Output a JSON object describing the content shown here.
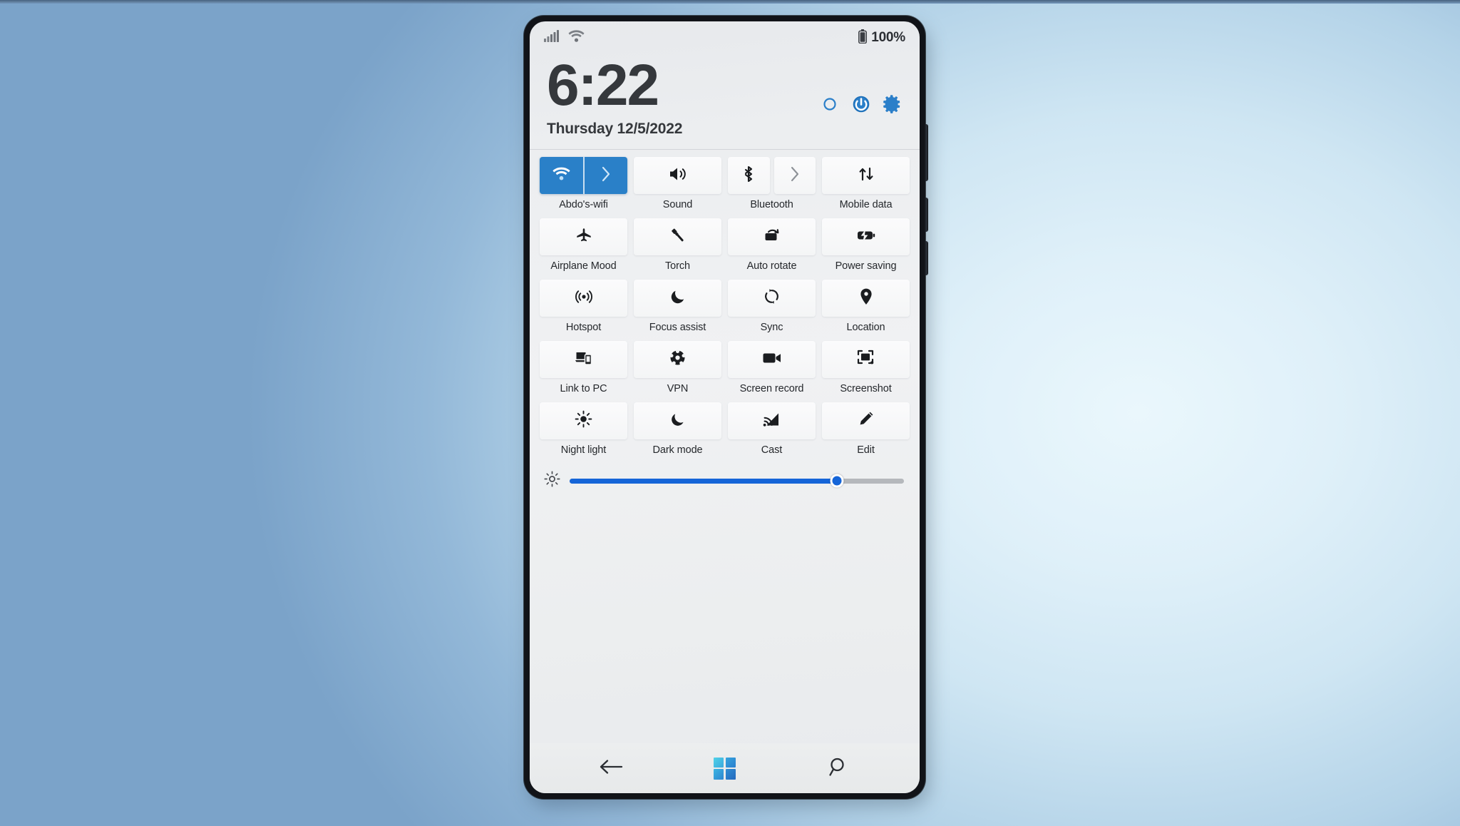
{
  "status_bar": {
    "signal_icon": "cellular-signal-icon",
    "wifi_icon": "wifi-icon",
    "battery_icon": "battery-full-icon",
    "battery_text": "100%"
  },
  "header": {
    "time": "6:22",
    "date": "Thursday 12/5/2022",
    "actions": [
      {
        "name": "night-light-ring-icon",
        "label": "Ring"
      },
      {
        "name": "power-icon",
        "label": "Power"
      },
      {
        "name": "gear-icon",
        "label": "Settings"
      }
    ]
  },
  "tiles": [
    {
      "label": "Abdo's-wifi",
      "icon": "wifi-icon",
      "state": "on",
      "layout": "split-joined"
    },
    {
      "label": "Sound",
      "icon": "speaker-icon",
      "state": "off",
      "layout": "single"
    },
    {
      "label": "Bluetooth",
      "icon": "bluetooth-icon",
      "state": "off",
      "layout": "split-pair"
    },
    {
      "label": "Mobile data",
      "icon": "data-transfer-icon",
      "state": "off",
      "layout": "single"
    },
    {
      "label": "Airplane Mood",
      "icon": "airplane-icon",
      "state": "off",
      "layout": "single"
    },
    {
      "label": "Torch",
      "icon": "flashlight-icon",
      "state": "off",
      "layout": "single"
    },
    {
      "label": "Auto rotate",
      "icon": "rotate-screen-icon",
      "state": "off",
      "layout": "single"
    },
    {
      "label": "Power saving",
      "icon": "battery-saver-icon",
      "state": "off",
      "layout": "single"
    },
    {
      "label": "Hotspot",
      "icon": "hotspot-icon",
      "state": "off",
      "layout": "single"
    },
    {
      "label": "Focus assist",
      "icon": "moon-icon",
      "state": "off",
      "layout": "single"
    },
    {
      "label": "Sync",
      "icon": "sync-icon",
      "state": "off",
      "layout": "single"
    },
    {
      "label": "Location",
      "icon": "location-pin-icon",
      "state": "off",
      "layout": "single"
    },
    {
      "label": "Link to PC",
      "icon": "link-to-pc-icon",
      "state": "off",
      "layout": "single"
    },
    {
      "label": "VPN",
      "icon": "vpn-shield-icon",
      "state": "off",
      "layout": "single"
    },
    {
      "label": "Screen record",
      "icon": "video-camera-icon",
      "state": "off",
      "layout": "single"
    },
    {
      "label": "Screenshot",
      "icon": "screenshot-icon",
      "state": "off",
      "layout": "single"
    },
    {
      "label": "Night light",
      "icon": "sun-icon",
      "state": "off",
      "layout": "single"
    },
    {
      "label": "Dark mode",
      "icon": "moon-filled-icon",
      "state": "off",
      "layout": "single"
    },
    {
      "label": "Cast",
      "icon": "cast-icon",
      "state": "off",
      "layout": "single"
    },
    {
      "label": "Edit",
      "icon": "pencil-icon",
      "state": "off",
      "layout": "single"
    }
  ],
  "brightness": {
    "icon": "brightness-icon",
    "value_percent": 80
  },
  "nav_bar": {
    "back": "back-arrow-icon",
    "home": "windows-logo-icon",
    "search": "search-icon"
  },
  "colors": {
    "accent_blue": "#2a80c8",
    "slider_blue": "#1565d8",
    "header_icon_blue": "#2b7fc9",
    "tile_bg": "#f7f8f9",
    "text": "#25282c"
  }
}
